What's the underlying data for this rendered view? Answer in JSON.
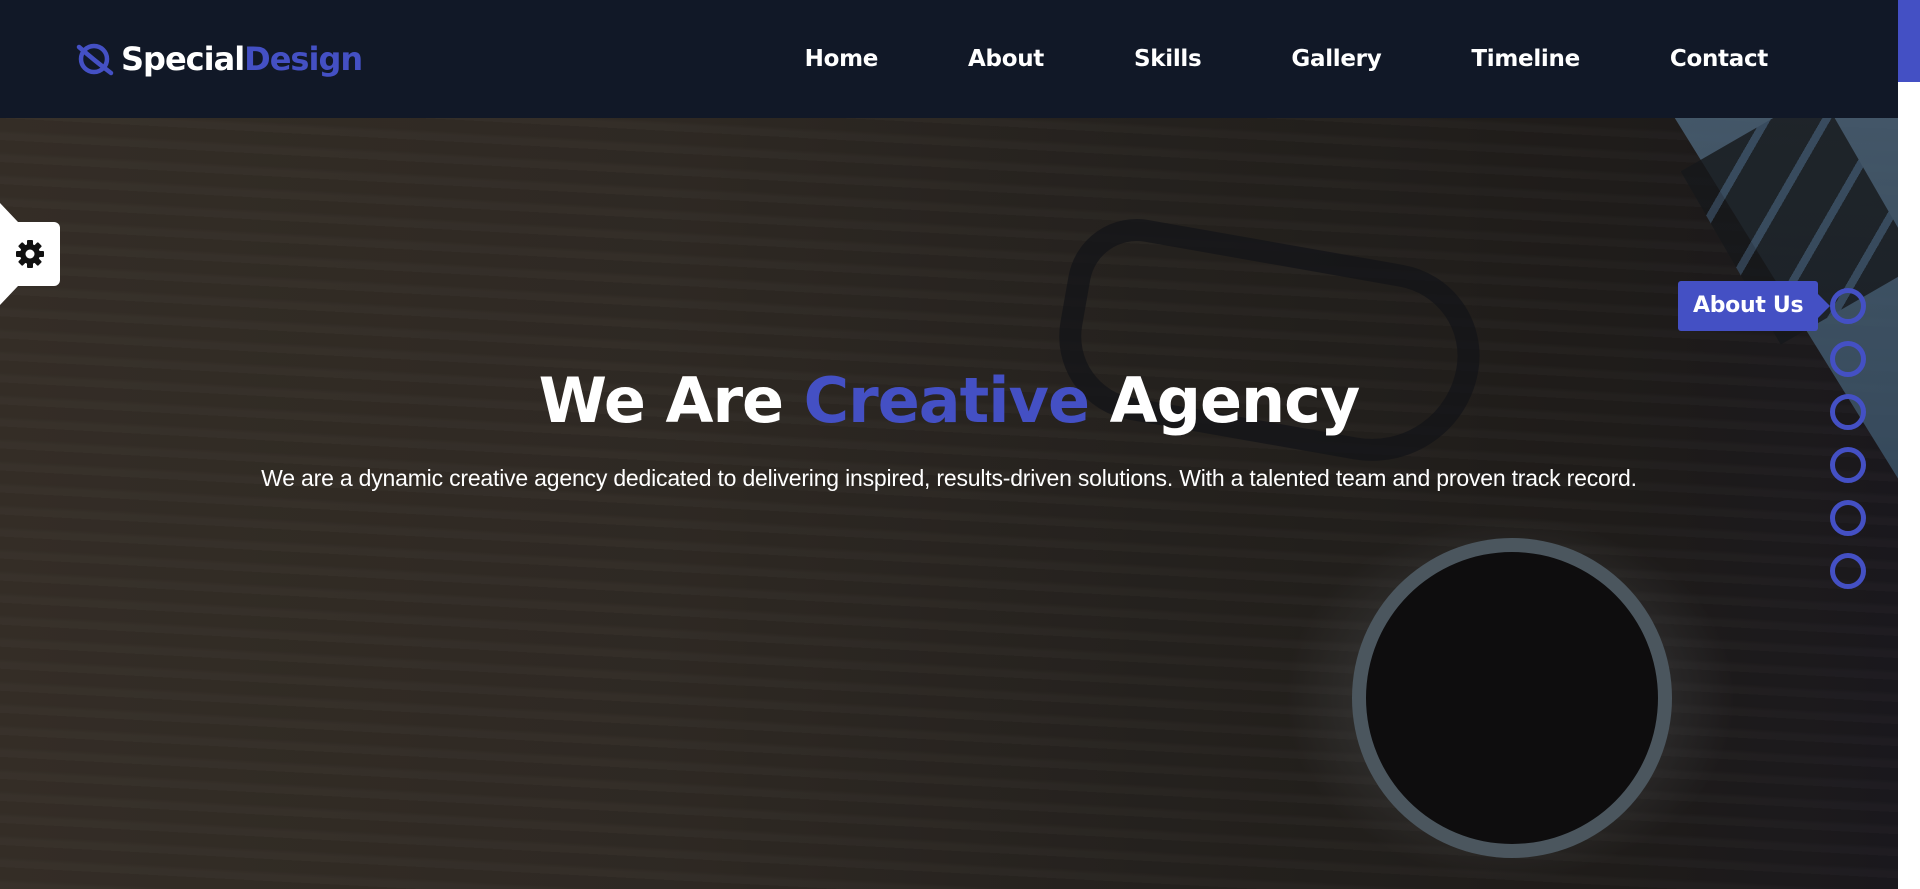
{
  "brand": {
    "name_part1": "Special",
    "name_part2": "Design",
    "icon": "planet-icon",
    "accent_color": "#4450c4"
  },
  "nav": {
    "items": [
      {
        "label": "Home"
      },
      {
        "label": "About"
      },
      {
        "label": "Skills"
      },
      {
        "label": "Gallery"
      },
      {
        "label": "Timeline"
      },
      {
        "label": "Contact"
      }
    ]
  },
  "hero": {
    "title_before": "We Are",
    "title_accent": "Creative",
    "title_after": "Agency",
    "description": "We are a dynamic creative agency dedicated to delivering inspired, results-driven solutions. With a talented team and proven track record."
  },
  "settings": {
    "icon": "gear-icon"
  },
  "bullets": {
    "count": 6,
    "active_tooltip": "About Us"
  },
  "colors": {
    "header_bg": "#111827",
    "accent": "#4450c4",
    "text": "#ffffff"
  }
}
